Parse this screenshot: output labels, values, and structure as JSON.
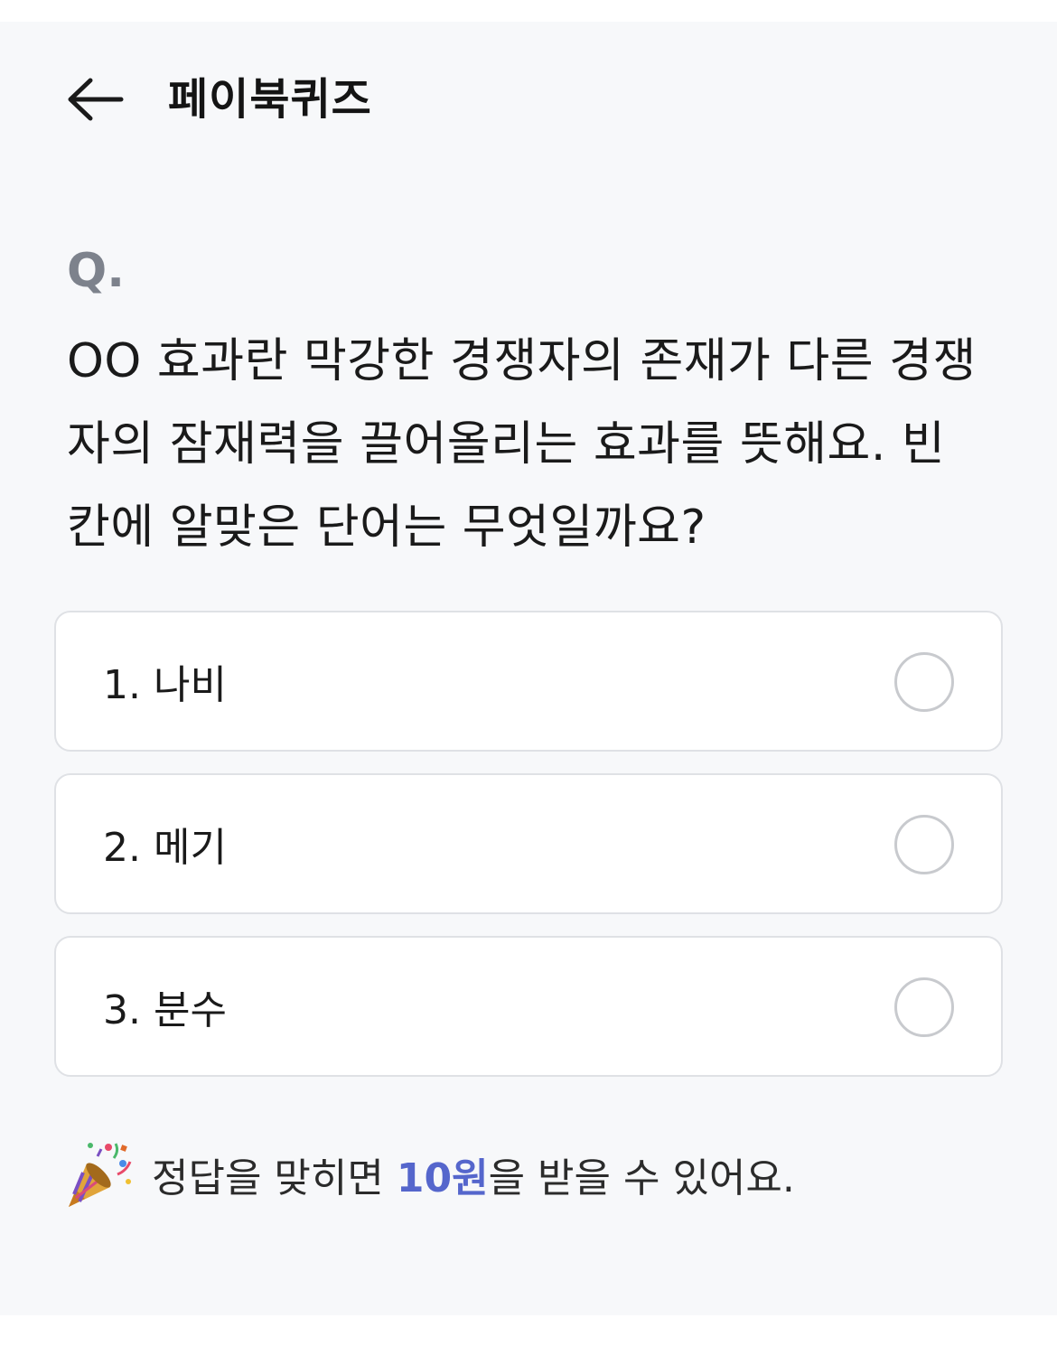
{
  "header": {
    "title": "페이북퀴즈",
    "back_icon": "arrow-left-icon"
  },
  "quiz": {
    "q_label": "Q.",
    "question": "OO 효과란 막강한 경쟁자의 존재가 다른 경쟁자의 잠재력을 끌어올리는 효과를 뜻해요. 빈 칸에 알맞은 단어는 무엇일까요?",
    "options": [
      {
        "label": "1. 나비"
      },
      {
        "label": "2. 메기"
      },
      {
        "label": "3. 분수"
      }
    ]
  },
  "reward": {
    "icon": "party-popper-icon",
    "text_before": "정답을 맞히면 ",
    "amount": "10원",
    "text_after": "을 받을 수 있어요."
  },
  "colors": {
    "background": "#f7f8fa",
    "option_border": "#dfe1e5",
    "accent": "#5566cc",
    "q_label": "#7d828c"
  }
}
